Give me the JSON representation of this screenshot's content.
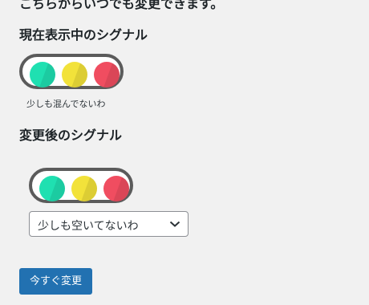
{
  "intro_text": "こちらからいつでも変更できます。",
  "current_section": {
    "heading": "現在表示中のシグナル",
    "status_caption": "少しも混んでないわ"
  },
  "new_section": {
    "heading": "変更後のシグナル",
    "select_value": "少しも空いてないわ"
  },
  "change_button": "今すぐ変更",
  "colors": {
    "green": "#1fe0b1",
    "yellow": "#f2e23a",
    "red": "#f04d60",
    "button": "#2271b1"
  }
}
